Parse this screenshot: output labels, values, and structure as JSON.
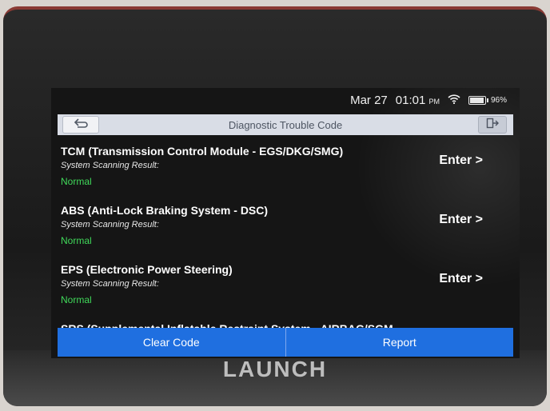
{
  "status": {
    "date": "Mar 27",
    "time": "01:01",
    "ampm": "PM",
    "battery": "96%",
    "battery_level": 0.96
  },
  "header": {
    "title": "Diagnostic Trouble Code"
  },
  "items": [
    {
      "title": "TCM (Transmission Control Module - EGS/DKG/SMG)",
      "subtitle": "System Scanning Result:",
      "status": "Normal",
      "action": "Enter >"
    },
    {
      "title": "ABS (Anti-Lock Braking System - DSC)",
      "subtitle": "System Scanning Result:",
      "status": "Normal",
      "action": "Enter >"
    },
    {
      "title": "EPS (Electronic Power Steering)",
      "subtitle": "System Scanning Result:",
      "status": "Normal",
      "action": "Enter >"
    },
    {
      "title": "SRS (Supplemental Inflatable Restraint System - AIRBAG/SGM"
    }
  ],
  "footer": {
    "clear_label": "Clear Code",
    "report_label": "Report"
  },
  "device": {
    "brand": "LAUNCH"
  },
  "colors": {
    "accent": "#1f6fe0",
    "status_normal": "#40d95a"
  }
}
